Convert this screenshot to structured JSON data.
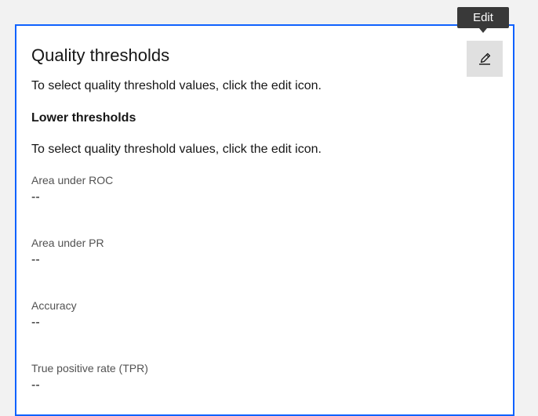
{
  "tooltip": {
    "edit": "Edit"
  },
  "panel": {
    "title": "Quality thresholds",
    "instruction": "To select quality threshold values, click the edit icon.",
    "lower_heading": "Lower thresholds",
    "lower_instruction": "To select quality threshold values, click the edit icon.",
    "metrics": [
      {
        "label": "Area under ROC",
        "value": "--"
      },
      {
        "label": "Area under PR",
        "value": "--"
      },
      {
        "label": "Accuracy",
        "value": "--"
      },
      {
        "label": "True positive rate (TPR)",
        "value": "--"
      }
    ]
  },
  "icons": {
    "edit": "edit-pencil-icon"
  },
  "colors": {
    "focus_border": "#0f62fe",
    "tooltip_bg": "#393939",
    "button_bg": "#e0e0e0"
  }
}
